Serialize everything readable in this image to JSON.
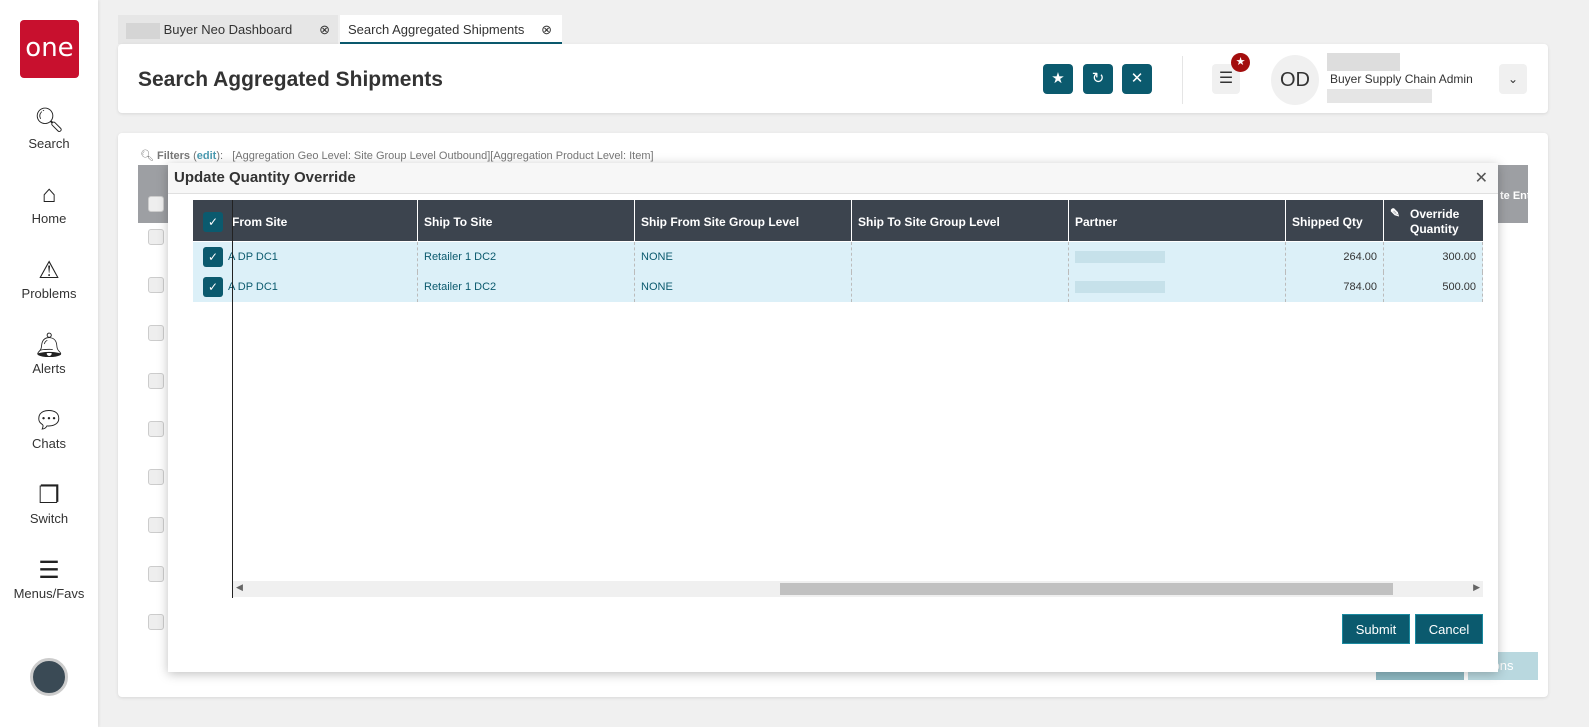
{
  "sidebar": {
    "logo": "one",
    "items": [
      {
        "label": "Search",
        "icon": "search-icon"
      },
      {
        "label": "Home",
        "icon": "home-icon"
      },
      {
        "label": "Problems",
        "icon": "warning-icon"
      },
      {
        "label": "Alerts",
        "icon": "bell-icon"
      },
      {
        "label": "Chats",
        "icon": "chat-icon"
      },
      {
        "label": "Switch",
        "icon": "switch-icon"
      },
      {
        "label": "Menus/Favs",
        "icon": "menu-icon"
      }
    ]
  },
  "tabs": [
    {
      "label": "Buyer Neo Dashboard"
    },
    {
      "label": "Search Aggregated Shipments"
    }
  ],
  "header": {
    "title": "Search Aggregated Shipments",
    "avatar": "OD",
    "role": "Buyer Supply Chain Admin"
  },
  "filters": {
    "label": "Filters",
    "edit": "edit",
    "text": "[Aggregation Geo Level: Site Group Level Outbound][Aggregation Product Level: Item]"
  },
  "background": {
    "partial_header": "te Ent",
    "actions": "ons"
  },
  "modal": {
    "title": "Update Quantity Override",
    "columns": [
      "From Site",
      "Ship To Site",
      "Ship From Site Group Level",
      "Ship To Site Group Level",
      "Partner",
      "Shipped Qty",
      "Override Quantity"
    ],
    "rows": [
      {
        "from": "A DP DC1",
        "to": "Retailer 1 DC2",
        "from_level": "NONE",
        "to_level": "",
        "partner": "",
        "shipped": "264.00",
        "override": "300.00"
      },
      {
        "from": "A DP DC1",
        "to": "Retailer 1 DC2",
        "from_level": "NONE",
        "to_level": "",
        "partner": "",
        "shipped": "784.00",
        "override": "500.00"
      }
    ],
    "submit": "Submit",
    "cancel": "Cancel"
  }
}
